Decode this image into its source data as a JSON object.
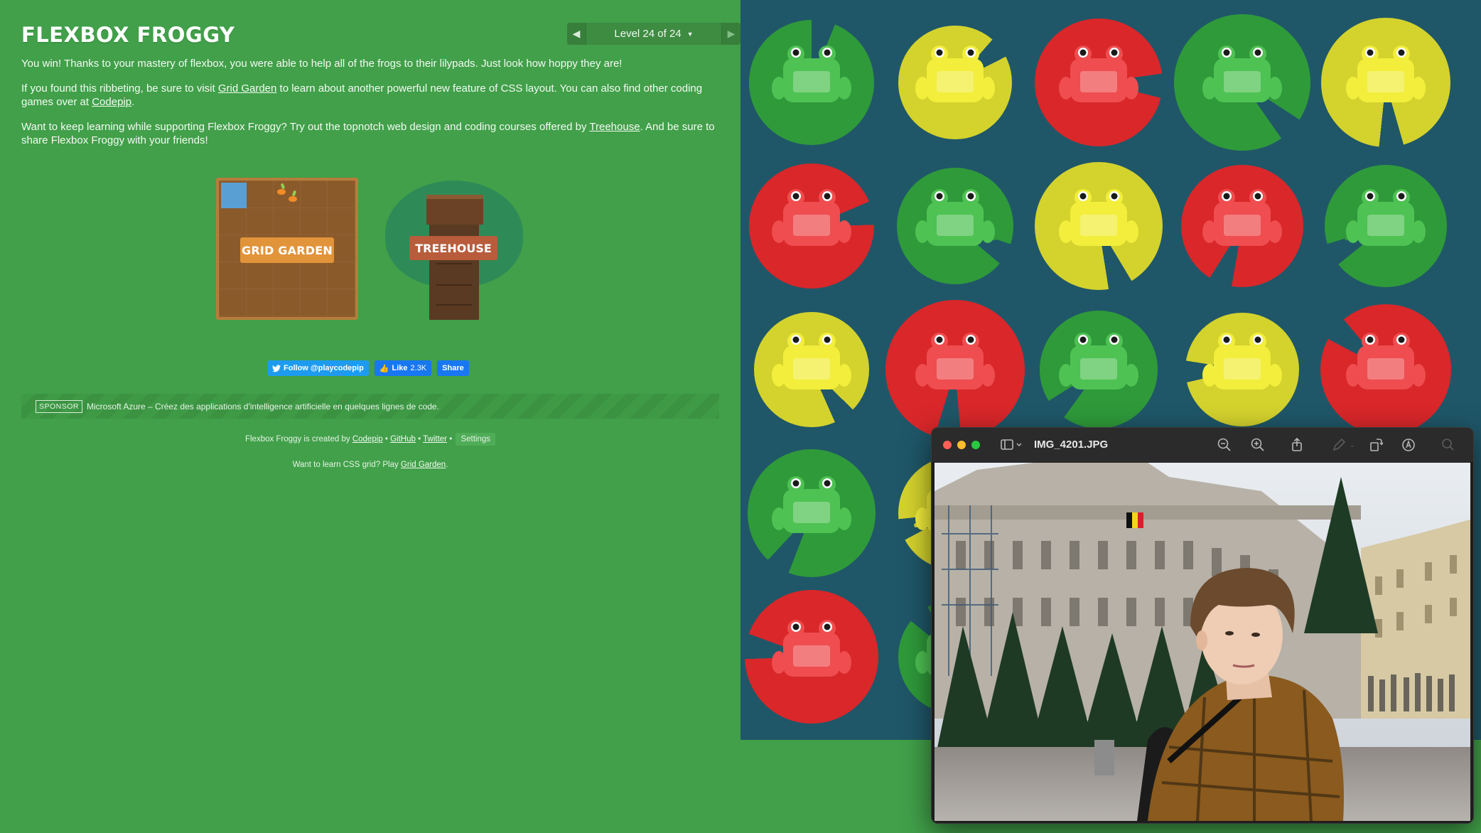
{
  "app": {
    "title": "FLEXBOX FROGGY",
    "level": {
      "label": "Level 24 of 24",
      "current": 24,
      "total": 24
    }
  },
  "win_text": {
    "p1": "You win! Thanks to your mastery of flexbox, you were able to help all of the frogs to their lilypads. Just look how hoppy they are!",
    "p2_before": "If you found this ribbeting, be sure to visit ",
    "p2_link1": "Grid Garden",
    "p2_middle": " to learn about another powerful new feature of CSS layout. You can also find other coding games over at ",
    "p2_link2": "Codepip",
    "p2_after": ".",
    "p3_before": "Want to keep learning while supporting Flexbox Froggy? Try out the topnotch web design and coding courses offered by ",
    "p3_link": "Treehouse",
    "p3_after": ". And be sure to share Flexbox Froggy with your friends!"
  },
  "cards": {
    "grid_garden": "GRID GARDEN",
    "treehouse": "TREEHOUSE"
  },
  "social": {
    "twitter": "Follow @playcodepip",
    "facebook_like": "Like",
    "like_count": "2.3K",
    "share": "Share"
  },
  "sponsor": {
    "tag": "SPONSOR",
    "text": "Microsoft Azure – Créez des applications d'intelligence artificielle en quelques lignes de code."
  },
  "footer": {
    "credit": "Flexbox Froggy is created by",
    "codepip": "Codepip",
    "sep": "•",
    "github": "GitHub",
    "twitter": "Twitter",
    "settings": "Settings",
    "learn_before": "Want to learn CSS grid? Play ",
    "learn_link": "Grid Garden",
    "learn_after": "."
  },
  "colors": {
    "background": "#41a049",
    "board": "#1f5768",
    "green_pad": "#2f9a3a",
    "green_frog": "#4ec253",
    "yellow_pad": "#d4d22d",
    "yellow_frog": "#f2ee3b",
    "red_pad": "#d9272a",
    "red_frog": "#ef4d4f"
  },
  "board": {
    "rows": [
      [
        "green",
        "yellow",
        "red",
        "green",
        "yellow"
      ],
      [
        "red",
        "green",
        "yellow",
        "red",
        "green"
      ],
      [
        "yellow",
        "red",
        "green",
        "yellow",
        "red"
      ],
      [
        "green",
        "yellow",
        "",
        "",
        ""
      ],
      [
        "red",
        "green",
        "",
        "",
        ""
      ]
    ]
  },
  "preview": {
    "filename": "IMG_4201.JPG",
    "toolbar_icons": [
      "sidebar-icon",
      "zoom-out-icon",
      "zoom-in-icon",
      "share-icon",
      "markup-icon",
      "rotate-icon",
      "annotate-icon",
      "search-icon"
    ]
  }
}
